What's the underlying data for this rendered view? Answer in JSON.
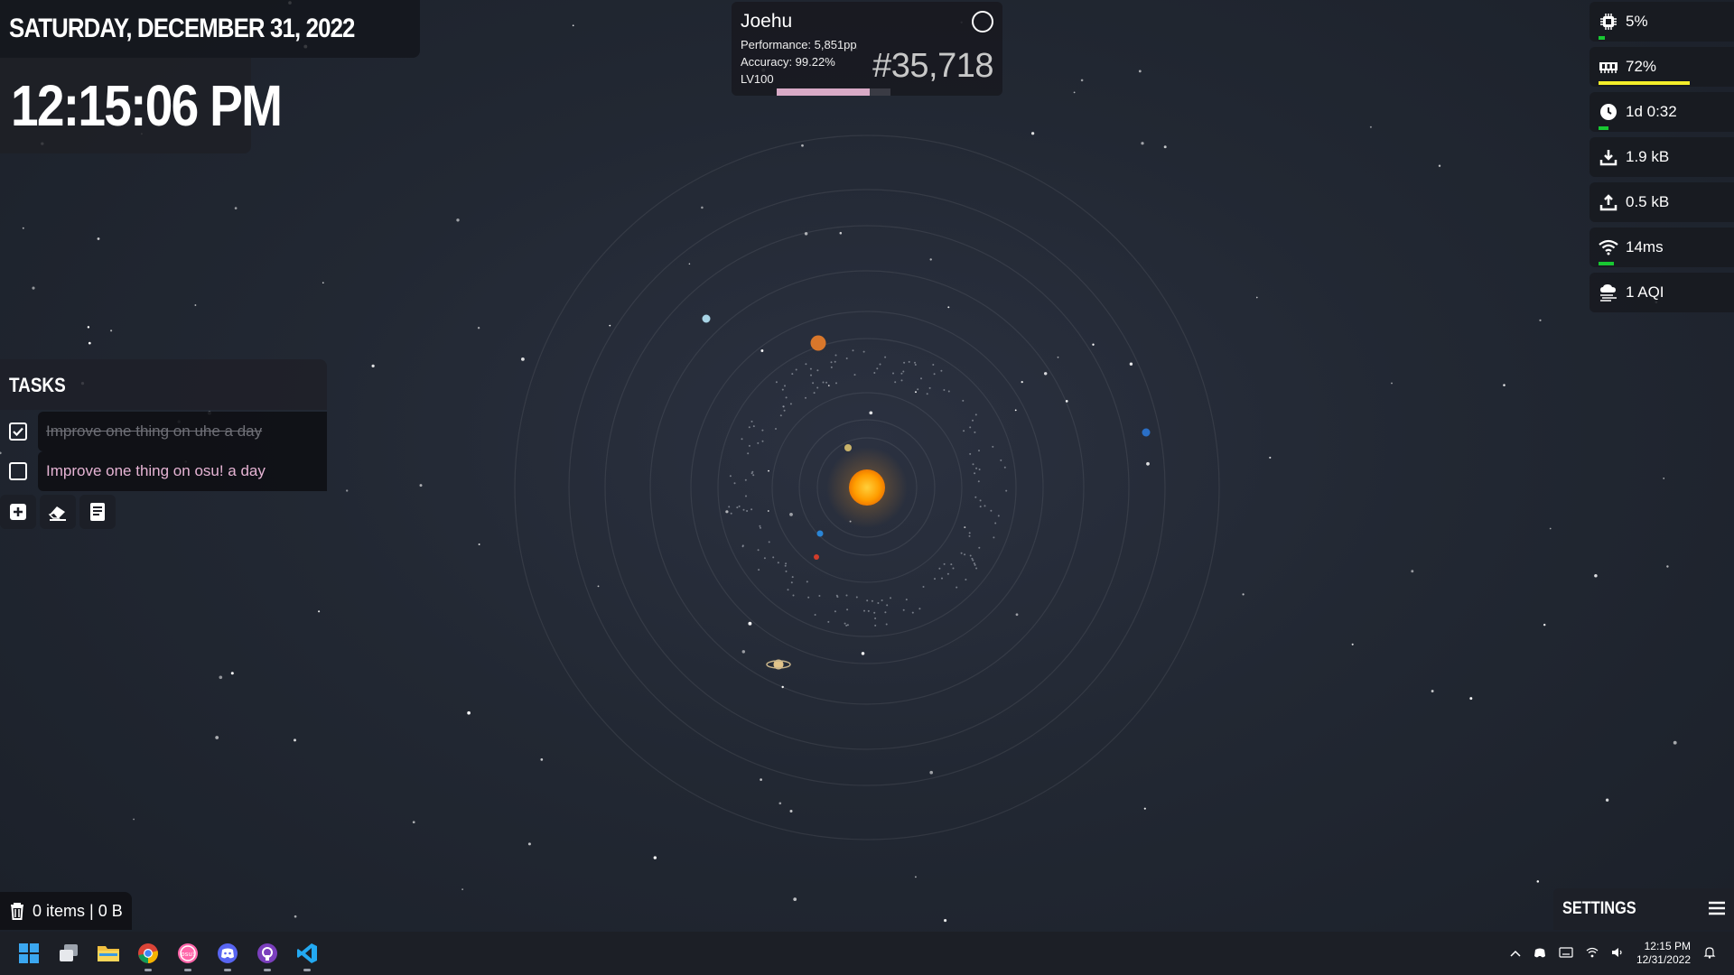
{
  "date": "SATURDAY, DECEMBER 31, 2022",
  "time": "12:15:06 PM",
  "profile": {
    "name": "Joehu",
    "performance": "Performance: 5,851pp",
    "accuracy": "Accuracy: 99.22%",
    "level": "LV100",
    "rank": "#35,718",
    "level_progress": 0.82
  },
  "stats": [
    {
      "icon": "cpu-icon",
      "value": "5%",
      "bar": 0.05,
      "bar_color": "#18c832"
    },
    {
      "icon": "memory-icon",
      "value": "72%",
      "bar": 0.72,
      "bar_color": "#f4ee2a"
    },
    {
      "icon": "clock-icon",
      "value": "1d 0:32",
      "bar": 0.08,
      "bar_color": "#18c832"
    },
    {
      "icon": "download-icon",
      "value": "1.9 kB"
    },
    {
      "icon": "upload-icon",
      "value": "0.5 kB"
    },
    {
      "icon": "wifi-icon",
      "value": "14ms",
      "bar": 0.12,
      "bar_color": "#18c832"
    },
    {
      "icon": "air-quality-icon",
      "value": "1 AQI"
    }
  ],
  "tasks": {
    "title": "TASKS",
    "items": [
      {
        "text": "Improve one thing on uhe a day",
        "done": true
      },
      {
        "text": "Improve one thing on osu! a day",
        "done": false
      }
    ]
  },
  "recycle_bin": "0 items | 0 B",
  "settings_label": "SETTINGS",
  "taskbar": {
    "apps": [
      "windows-start-icon",
      "task-view-icon",
      "file-explorer-icon",
      "chrome-icon",
      "osu-icon",
      "discord-icon",
      "github-desktop-icon",
      "vscode-icon"
    ],
    "clock_time": "12:15 PM",
    "clock_date": "12/31/2022"
  }
}
